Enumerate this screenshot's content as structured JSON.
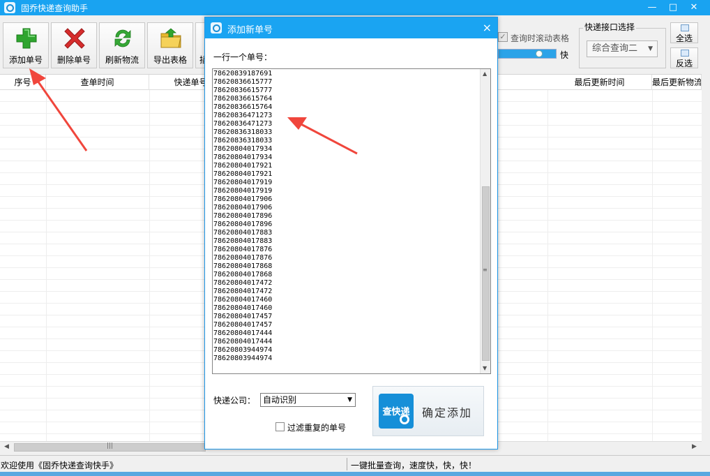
{
  "window": {
    "title": "固乔快递查询助手",
    "controls": [
      "—",
      "□",
      "✕"
    ]
  },
  "toolbar": {
    "buttons": [
      {
        "label": "添加单号",
        "icon": "plus-icon"
      },
      {
        "label": "删除单号",
        "icon": "delete-x-icon"
      },
      {
        "label": "刷新物流",
        "icon": "refresh-icon"
      },
      {
        "label": "导出表格",
        "icon": "folder-export-icon"
      },
      {
        "label": "插",
        "icon": "partially-hidden-icon"
      }
    ],
    "scroll_option_label": "查询时滚动表格",
    "scroll_option_checked": true,
    "speed_label": "快",
    "interface_group_title": "快递接口选择",
    "interface_selected": "综合查询二",
    "select_all_label": "全选",
    "invert_select_label": "反选"
  },
  "grid": {
    "columns": [
      "序号",
      "查单时间",
      "快递单号",
      "最后更新时间",
      "最后更新物流"
    ]
  },
  "status": {
    "left": "欢迎使用《固乔快递查询快手》",
    "right": "一键批量查询，速度快，快，快！"
  },
  "dialog": {
    "title": "添加新单号",
    "close": "×",
    "prompt": "一行一个单号：",
    "tracking_numbers": [
      "78620839187691",
      "78620836615777",
      "78620836615777",
      "78620836615764",
      "78620836615764",
      "78620836471273",
      "78620836471273",
      "78620836318033",
      "78620836318033",
      "78620804017934",
      "78620804017934",
      "78620804017921",
      "78620804017921",
      "78620804017919",
      "78620804017919",
      "78620804017906",
      "78620804017906",
      "78620804017896",
      "78620804017896",
      "78620804017883",
      "78620804017883",
      "78620804017876",
      "78620804017876",
      "78620804017868",
      "78620804017868",
      "78620804017472",
      "78620804017472",
      "78620804017460",
      "78620804017460",
      "78620804017457",
      "78620804017457",
      "78620804017444",
      "78620804017444",
      "78620803944974",
      "78620803944974"
    ],
    "company_label": "快递公司：",
    "company_selected": "自动识别",
    "filter_label": "过滤重复的单号",
    "filter_checked": false,
    "confirm_logo_text": "查快递",
    "confirm_label": "确定添加"
  },
  "colors": {
    "titlebar": "#19a3f1",
    "accent": "#168fd8",
    "annotation_arrow": "#f0463c"
  }
}
